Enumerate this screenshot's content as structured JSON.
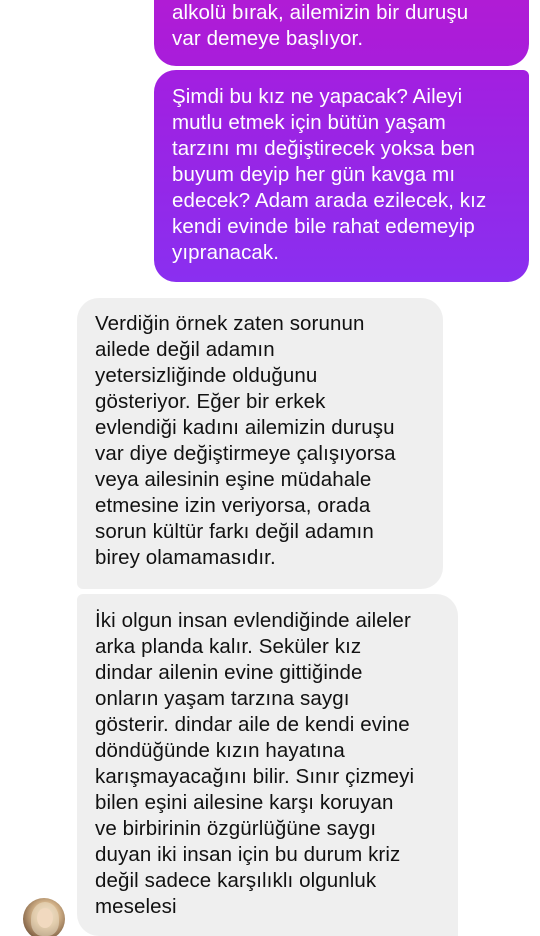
{
  "conversation": {
    "messages": [
      {
        "direction": "outgoing",
        "text": "alkolü bırak, ailemizin bir duruşu\nvar demeye başlıyor."
      },
      {
        "direction": "outgoing",
        "text": "Şimdi bu kız ne yapacak? Aileyi\nmutlu etmek için bütün yaşam\ntarzını mı değiştirecek yoksa ben\nbuyum deyip her gün kavga mı\nedecek? Adam arada ezilecek, kız\nkendi evinde bile rahat edemeyip\nyıpranacak."
      },
      {
        "direction": "incoming",
        "text": "Verdiğin örnek zaten sorunun\nailede değil adamın\nyetersizliğinde olduğunu\ngösteriyor. Eğer bir erkek\nevlendiği kadını ailemizin duruşu\nvar diye değiştirmeye çalışıyorsa\nveya ailesinin eşine müdahale\netmesine izin veriyorsa, orada\nsorun kültür farkı değil adamın\nbirey olamamasıdır."
      },
      {
        "direction": "incoming",
        "text": "İki olgun insan evlendiğinde aileler\narka planda kalır. Seküler kız\ndindar ailenin evine gittiğinde\nonların yaşam tarzına saygı\ngösterir. dindar aile de kendi evine\ndöndüğünde kızın hayatına\nkarışmayacağını bilir. Sınır çizmeyi\nbilen eşini ailesine karşı koruyan\nve birbirinin özgürlüğüne saygı\nduyan iki insan için bu durum kriz\ndeğil sadece karşılıklı olgunluk\nmeselesi"
      }
    ]
  },
  "colors": {
    "outgoing_gradient_top": "#a31fe0",
    "outgoing_gradient_bottom": "#8a2ff0",
    "incoming_bubble": "#efefef",
    "incoming_text": "#111111",
    "outgoing_text": "#ffffff"
  },
  "icons": {
    "avatar": "contact-avatar-photo"
  }
}
